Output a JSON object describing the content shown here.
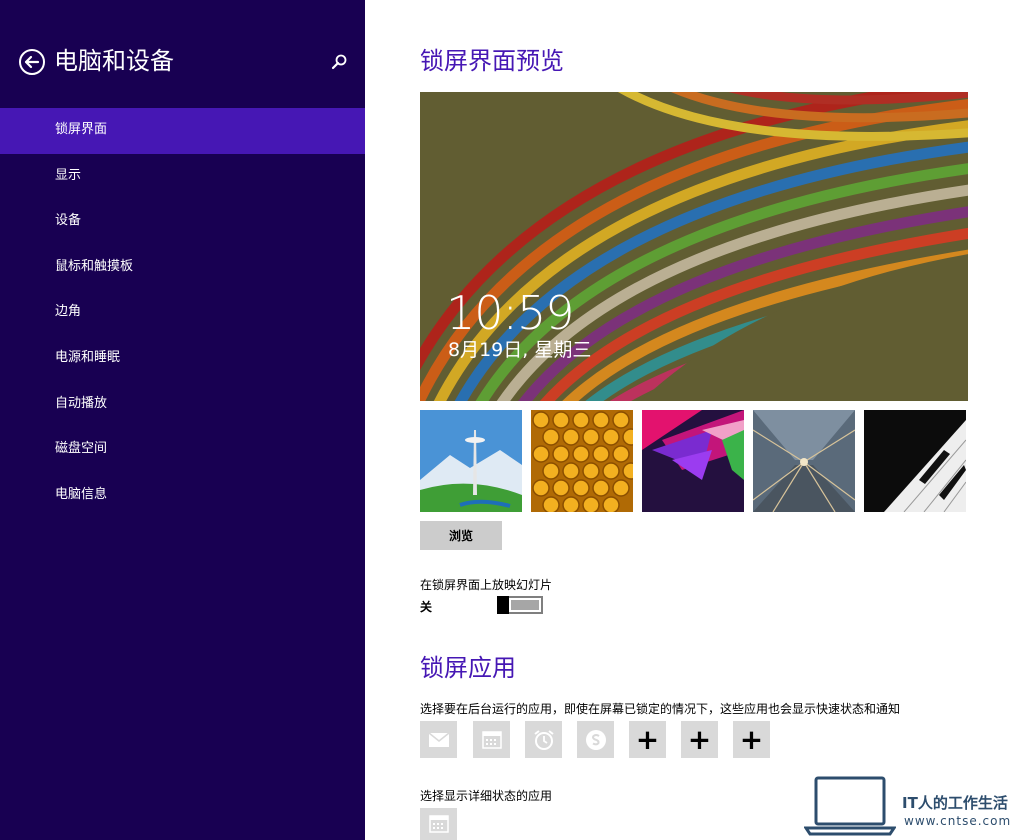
{
  "sidebar": {
    "title": "电脑和设备",
    "items": [
      {
        "label": "锁屏界面",
        "active": true
      },
      {
        "label": "显示"
      },
      {
        "label": "设备"
      },
      {
        "label": "鼠标和触摸板"
      },
      {
        "label": "边角"
      },
      {
        "label": "电源和睡眠"
      },
      {
        "label": "自动播放"
      },
      {
        "label": "磁盘空间"
      },
      {
        "label": "电脑信息"
      }
    ]
  },
  "main": {
    "preview_title": "锁屏界面预览",
    "preview": {
      "time": "10:59",
      "date": "8月19日, 星期三"
    },
    "browse_label": "浏览",
    "slideshow": {
      "label": "在锁屏界面上放映幻灯片",
      "state": "关",
      "on": false
    },
    "lock_apps": {
      "title": "锁屏应用",
      "description": "选择要在后台运行的应用，即使在屏幕已锁定的情况下，这些应用也会显示快速状态和通知",
      "apps": [
        "mail-icon",
        "calendar-icon",
        "alarm-icon",
        "skype-icon",
        "plus-icon",
        "plus-icon",
        "plus-icon"
      ],
      "plus_symbol": "+",
      "detail_label": "选择显示详细状态的应用",
      "detail_app": "calendar-icon"
    }
  },
  "watermark": {
    "title": "IT人的工作生活",
    "url": "www.cntse.com"
  },
  "colors": {
    "sidebar_bg": "#180052",
    "accent": "#4617b4",
    "tile_bg": "#d9d9d9"
  }
}
